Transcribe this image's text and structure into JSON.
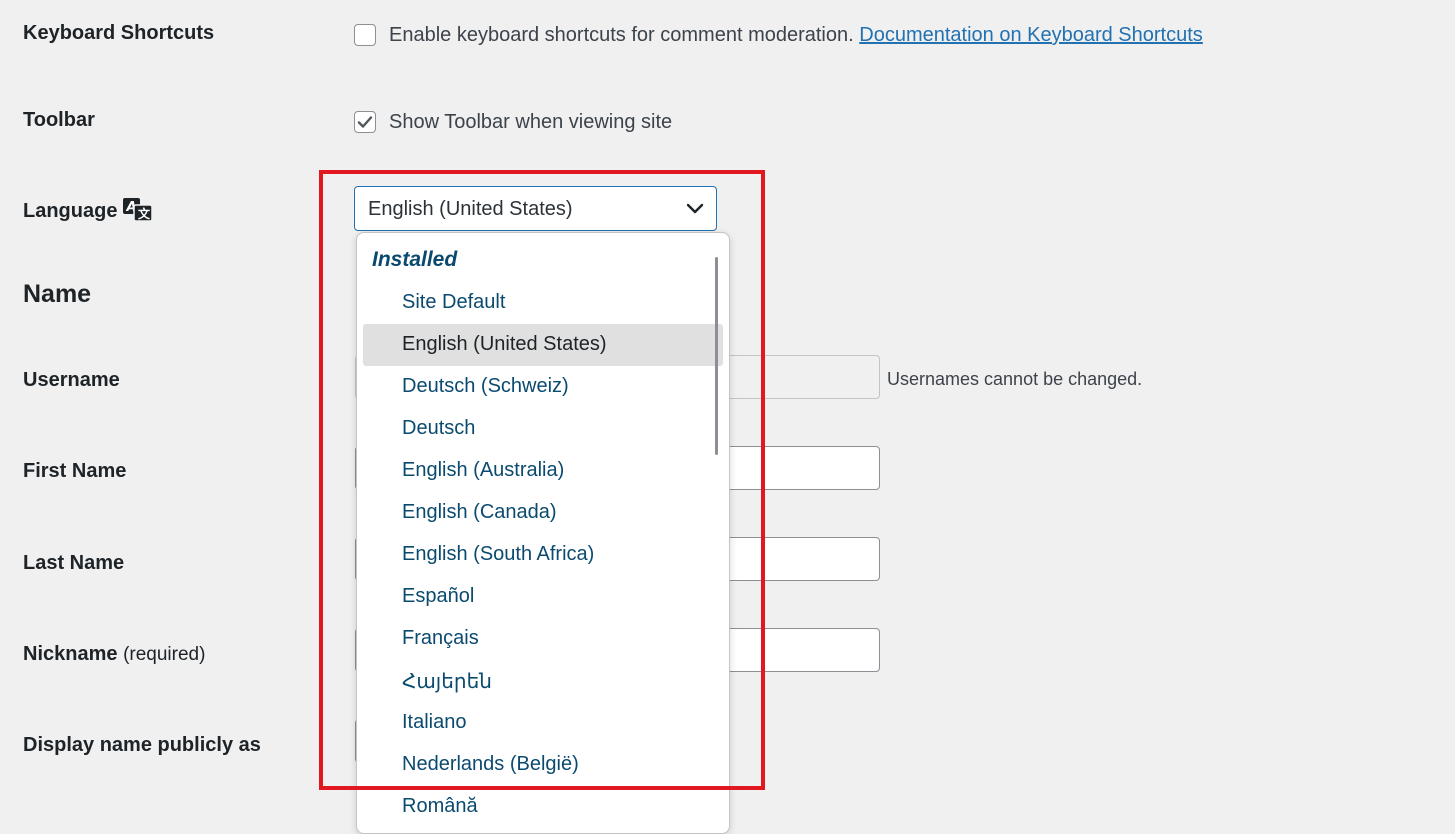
{
  "rows": {
    "keyboard_shortcuts": {
      "label": "Keyboard Shortcuts",
      "checkbox_text": "Enable keyboard shortcuts for comment moderation.",
      "link_text": "Documentation on Keyboard Shortcuts",
      "checked": false
    },
    "toolbar": {
      "label": "Toolbar",
      "checkbox_text": "Show Toolbar when viewing site",
      "checked": true
    },
    "language": {
      "label": "Language",
      "icon": "translate-icon",
      "selected_value": "English (United States)"
    }
  },
  "name_section": {
    "title": "Name",
    "username_label": "Username",
    "username_hint": "Usernames cannot be changed.",
    "first_name_label": "First Name",
    "last_name_label": "Last Name",
    "nickname_label": "Nickname",
    "nickname_required": "(required)",
    "display_name_label": "Display name publicly as"
  },
  "dropdown": {
    "group_label": "Installed",
    "options": [
      "Site Default",
      "English (United States)",
      "Deutsch (Schweiz)",
      "Deutsch",
      "English (Australia)",
      "English (Canada)",
      "English (South Africa)",
      "Español",
      "Français",
      "Հայերեն",
      "Italiano",
      "Nederlands (België)",
      "Română"
    ],
    "selected_index": 1
  },
  "colors": {
    "highlight": "#e1181f",
    "option_text": "#0b4a6f",
    "link": "#2271b1"
  }
}
